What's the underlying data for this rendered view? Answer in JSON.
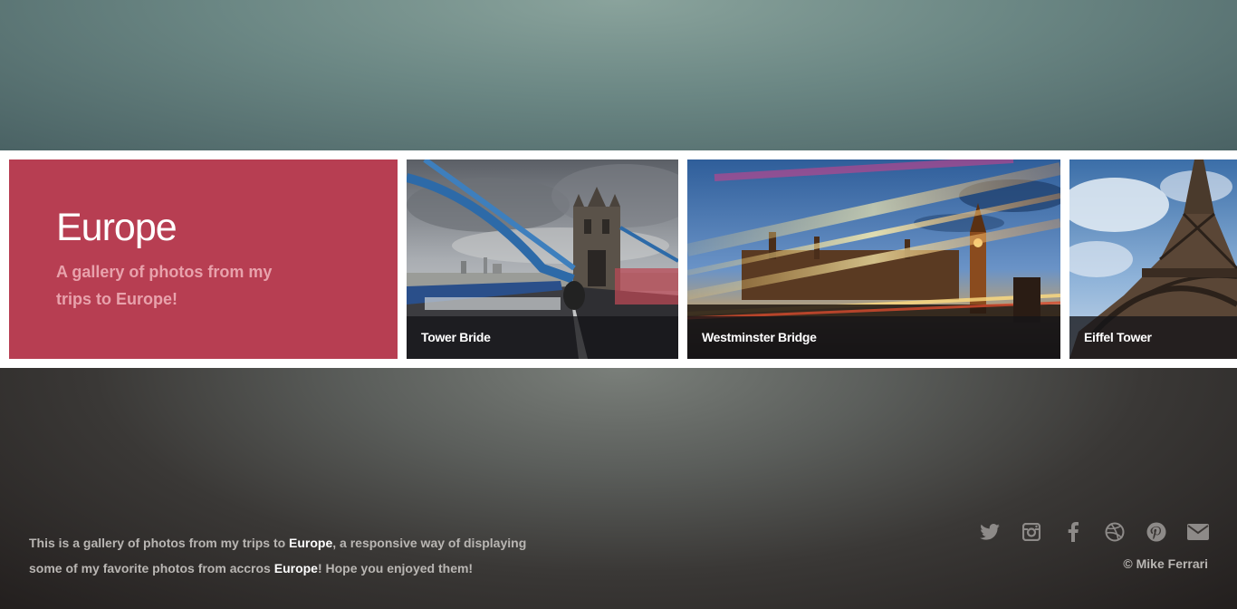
{
  "hero": {
    "title": "Europe",
    "subtitle": "A gallery of photos from my trips to Europe!"
  },
  "gallery": [
    {
      "caption": "Tower Bride"
    },
    {
      "caption": "Westminster Bridge"
    },
    {
      "caption": "Eiffel Tower"
    }
  ],
  "footer": {
    "text_1": "This is a gallery of photos from my trips to ",
    "bold_1": "Europe",
    "text_2": ", a responsive way of displaying some of my favorite photos from accros ",
    "bold_2": "Europe",
    "text_3": "! Hope you enjoyed them!",
    "copyright": "© Mike Ferrari"
  },
  "social_icons": [
    "twitter-icon",
    "instagram-icon",
    "facebook-icon",
    "dribbble-icon",
    "pinterest-icon",
    "mail-icon"
  ],
  "colors": {
    "hero_bg": "#b73e52",
    "caption_bg": "#141418",
    "footer_text": "#b9b6b3",
    "icon": "#8d8a88"
  }
}
